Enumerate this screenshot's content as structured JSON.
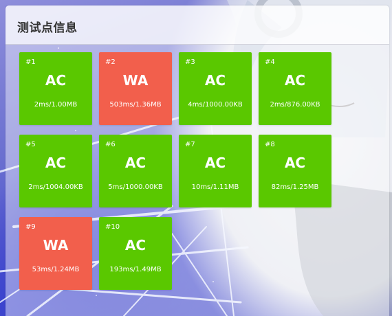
{
  "panel": {
    "title": "测试点信息"
  },
  "colors": {
    "accepted": "#5ac800",
    "wrong_answer": "#f25f4c"
  },
  "testcases": [
    {
      "num": "#1",
      "status": "AC",
      "detail": "2ms/1.00MB"
    },
    {
      "num": "#2",
      "status": "WA",
      "detail": "503ms/1.36MB"
    },
    {
      "num": "#3",
      "status": "AC",
      "detail": "4ms/1000.00KB"
    },
    {
      "num": "#4",
      "status": "AC",
      "detail": "2ms/876.00KB"
    },
    {
      "num": "#5",
      "status": "AC",
      "detail": "2ms/1004.00KB"
    },
    {
      "num": "#6",
      "status": "AC",
      "detail": "5ms/1000.00KB"
    },
    {
      "num": "#7",
      "status": "AC",
      "detail": "10ms/1.11MB"
    },
    {
      "num": "#8",
      "status": "AC",
      "detail": "82ms/1.25MB"
    },
    {
      "num": "#9",
      "status": "WA",
      "detail": "53ms/1.24MB"
    },
    {
      "num": "#10",
      "status": "AC",
      "detail": "193ms/1.49MB"
    }
  ]
}
